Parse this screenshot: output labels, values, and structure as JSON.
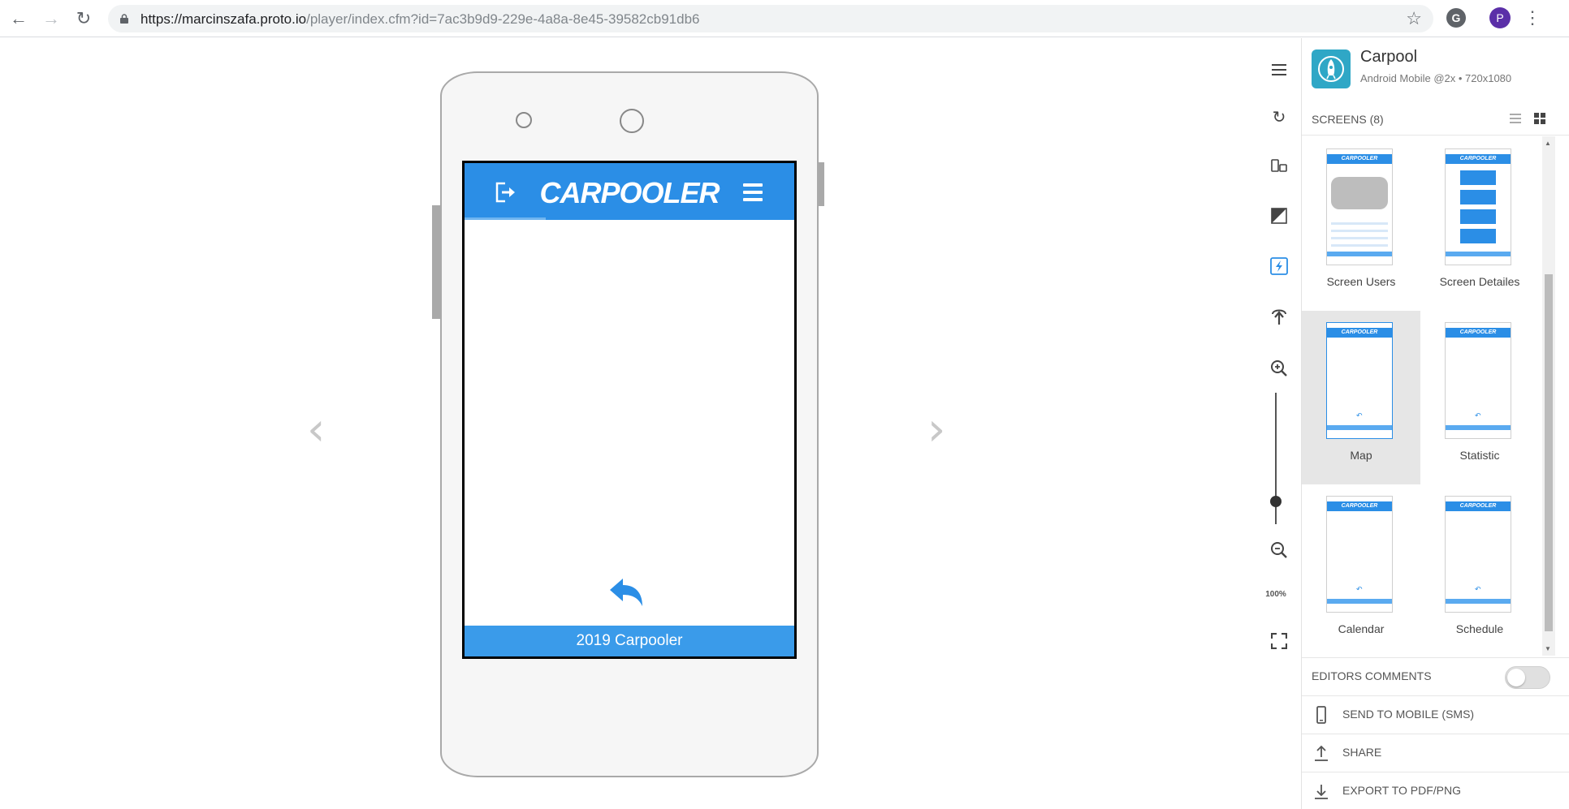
{
  "browser": {
    "url_host": "https://marcinszafa.proto.io",
    "url_path": "/player/index.cfm?id=7ac3b9d9-229e-4a8a-8e45-39582cb91db6",
    "profile_initial": "P",
    "extension_letter": "G"
  },
  "app_screen": {
    "brand": "CARPOOLER",
    "footer": "2019 Carpooler",
    "accent": "#2b8ee6"
  },
  "toolbar": {
    "zoom_label": "100%"
  },
  "panel": {
    "project_name": "Carpool",
    "project_meta": "Android Mobile @2x • 720x1080",
    "screens_title": "SCREENS (8)",
    "screens": [
      {
        "label": "Screen Users",
        "thumb_brand": "CARPOOLER"
      },
      {
        "label": "Screen Detailes",
        "thumb_brand": "CARPOOLER"
      },
      {
        "label": "Map",
        "thumb_brand": "CARPOOLER"
      },
      {
        "label": "Statistic",
        "thumb_brand": "CARPOOLER"
      },
      {
        "label": "Calendar",
        "thumb_brand": "CARPOOLER"
      },
      {
        "label": "Schedule",
        "thumb_brand": "CARPOOLER"
      }
    ],
    "editors_comments": "EDITORS COMMENTS",
    "send_to_mobile": "SEND TO MOBILE (SMS)",
    "share": "SHARE",
    "export": "EXPORT TO PDF/PNG"
  }
}
